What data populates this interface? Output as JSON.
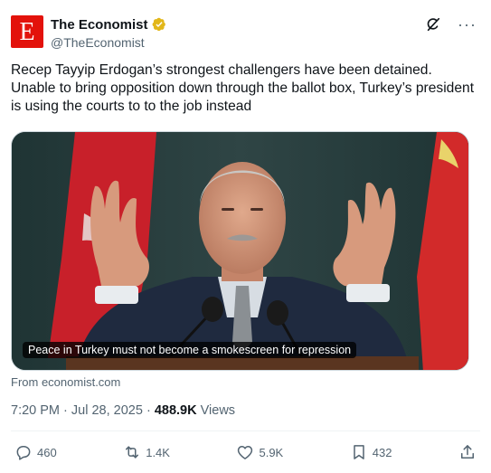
{
  "author": {
    "display_name": "The Economist",
    "handle": "@TheEconomist",
    "avatar_letter": "E",
    "avatar_color": "#e3120b",
    "verified": true,
    "verified_badge_color": "#e2b719"
  },
  "header_icons": [
    "grok-icon",
    "more-icon"
  ],
  "more_label": "···",
  "tweet": {
    "text": "Recep Tayyip Erdogan’s strongest challengers have been detained. Unable to bring opposition down through the ballot box, Turkey’s president is using the courts to to the job instead"
  },
  "media": {
    "caption": "Peace in Turkey must not become a smokescreen for repression",
    "source": "From economist.com"
  },
  "meta": {
    "time": "7:20 PM",
    "separator": "·",
    "date": "Jul 28, 2025",
    "views_count": "488.9K",
    "views_label": "Views"
  },
  "actions": {
    "replies": "460",
    "reposts": "1.4K",
    "likes": "5.9K",
    "bookmarks": "432"
  },
  "colors": {
    "text_primary": "#0f1419",
    "text_secondary": "#536471",
    "divider": "#eff3f4",
    "flag_red": "#d8202a"
  }
}
